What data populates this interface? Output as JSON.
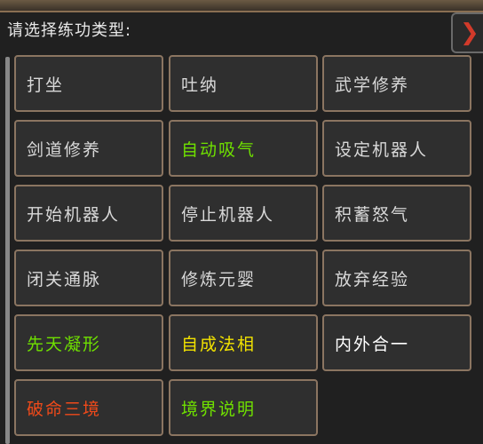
{
  "dialog": {
    "title": "请选择练功类型:",
    "close_icon": "close-icon"
  },
  "colors": {
    "default": "#d8d8d8",
    "green": "#6fe000",
    "yellow": "#f2e200",
    "white": "#ffffff",
    "red": "#f04a1a"
  },
  "options": [
    {
      "label": "打坐",
      "color": "default"
    },
    {
      "label": "吐纳",
      "color": "default"
    },
    {
      "label": "武学修养",
      "color": "default"
    },
    {
      "label": "剑道修养",
      "color": "default"
    },
    {
      "label": "自动吸气",
      "color": "green"
    },
    {
      "label": "设定机器人",
      "color": "default"
    },
    {
      "label": "开始机器人",
      "color": "default"
    },
    {
      "label": "停止机器人",
      "color": "default"
    },
    {
      "label": "积蓄怒气",
      "color": "default"
    },
    {
      "label": "闭关通脉",
      "color": "default"
    },
    {
      "label": "修炼元婴",
      "color": "default"
    },
    {
      "label": "放弃经验",
      "color": "default"
    },
    {
      "label": "先天凝形",
      "color": "green"
    },
    {
      "label": "自成法相",
      "color": "yellow"
    },
    {
      "label": "内外合一",
      "color": "white"
    },
    {
      "label": "破命三境",
      "color": "red"
    },
    {
      "label": "境界说明",
      "color": "green"
    }
  ]
}
